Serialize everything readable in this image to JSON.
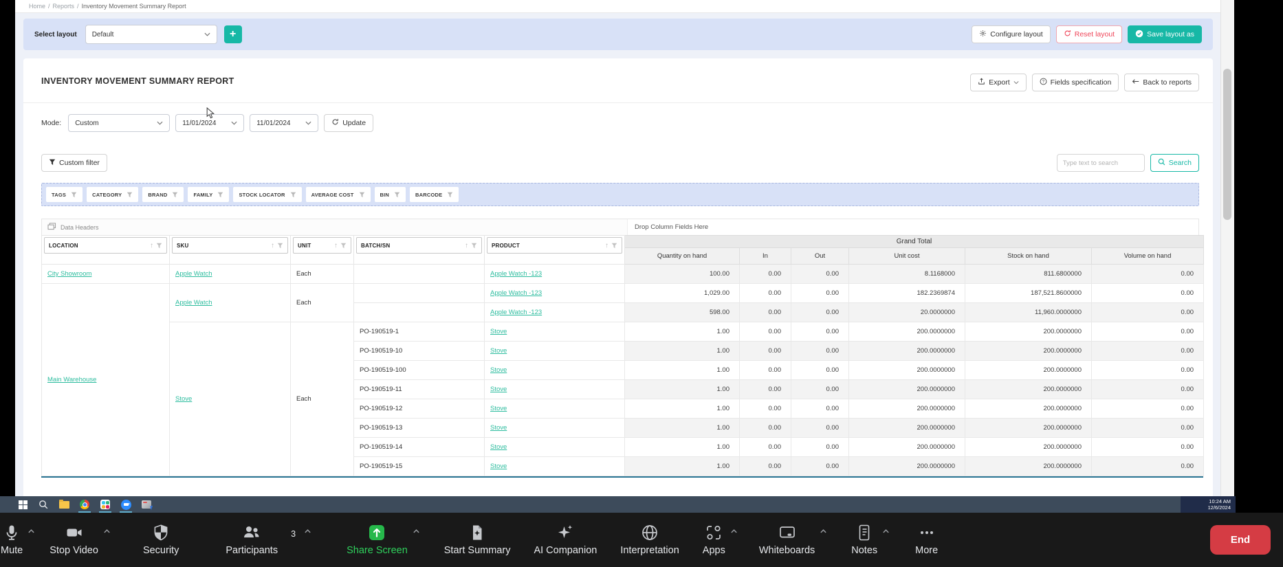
{
  "breadcrumb": {
    "items": [
      "Home",
      "Reports",
      "Inventory Movement Summary Report"
    ],
    "separator": "/"
  },
  "layout_bar": {
    "select_label": "Select layout",
    "selected": "Default",
    "add": "+",
    "configure": "Configure layout",
    "reset": "Reset layout",
    "save_as": "Save layout as"
  },
  "report": {
    "title": "INVENTORY MOVEMENT SUMMARY REPORT"
  },
  "toolbar": {
    "export": "Export",
    "fields_specification": "Fields specification",
    "back_to_reports": "Back to reports"
  },
  "filters": {
    "mode_label": "Mode:",
    "mode_value": "Custom",
    "date_from": "11/01/2024",
    "date_to": "11/01/2024",
    "update": "Update",
    "custom_filter": "Custom filter",
    "search_placeholder": "Type text to search",
    "search": "Search"
  },
  "chips": [
    "TAGS",
    "CATEGORY",
    "BRAND",
    "FAMILY",
    "STOCK LOCATOR",
    "AVERAGE COST",
    "BIN",
    "BARCODE"
  ],
  "grid": {
    "data_headers": "Data Headers",
    "drop_here": "Drop Column Fields Here",
    "grand_total": "Grand Total",
    "left_headers": [
      "LOCATION",
      "SKU",
      "UNIT",
      "BATCH/SN",
      "PRODUCT"
    ],
    "value_headers": [
      "Quantity on hand",
      "In",
      "Out",
      "Unit cost",
      "Stock on hand",
      "Volume on hand"
    ],
    "rows": [
      {
        "cells": [
          {
            "v": "City Showroom",
            "k": "link"
          },
          {
            "v": "Apple Watch",
            "k": "link"
          },
          {
            "v": "Each",
            "k": "text"
          },
          {
            "v": "",
            "k": "text"
          },
          {
            "v": "Apple Watch -123",
            "k": "link"
          },
          {
            "v": "100.00",
            "k": "num"
          },
          {
            "v": "0.00",
            "k": "num"
          },
          {
            "v": "0.00",
            "k": "num"
          },
          {
            "v": "8.1168000",
            "k": "num"
          },
          {
            "v": "811.6800000",
            "k": "num"
          },
          {
            "v": "0.00",
            "k": "num"
          }
        ]
      },
      {
        "cells": [
          {
            "v": "Main Warehouse",
            "k": "link",
            "rs": 10
          },
          {
            "v": "Apple Watch",
            "k": "link",
            "rs": 2
          },
          {
            "v": "Each",
            "k": "text",
            "rs": 2
          },
          {
            "v": "",
            "k": "text"
          },
          {
            "v": "Apple Watch -123",
            "k": "link"
          },
          {
            "v": "1,029.00",
            "k": "num"
          },
          {
            "v": "0.00",
            "k": "num"
          },
          {
            "v": "0.00",
            "k": "num"
          },
          {
            "v": "182.2369874",
            "k": "num"
          },
          {
            "v": "187,521.8600000",
            "k": "num"
          },
          {
            "v": "0.00",
            "k": "num"
          }
        ]
      },
      {
        "cells": [
          {
            "v": "",
            "k": "text"
          },
          {
            "v": "Apple Watch -123",
            "k": "link"
          },
          {
            "v": "598.00",
            "k": "num"
          },
          {
            "v": "0.00",
            "k": "num"
          },
          {
            "v": "0.00",
            "k": "num"
          },
          {
            "v": "20.0000000",
            "k": "num"
          },
          {
            "v": "11,960.0000000",
            "k": "num"
          },
          {
            "v": "0.00",
            "k": "num"
          }
        ]
      },
      {
        "cells": [
          {
            "v": "Stove",
            "k": "link",
            "rs": 8
          },
          {
            "v": "Each",
            "k": "text",
            "rs": 8
          },
          {
            "v": "PO-190519-1",
            "k": "text"
          },
          {
            "v": "Stove",
            "k": "link"
          },
          {
            "v": "1.00",
            "k": "num"
          },
          {
            "v": "0.00",
            "k": "num"
          },
          {
            "v": "0.00",
            "k": "num"
          },
          {
            "v": "200.0000000",
            "k": "num"
          },
          {
            "v": "200.0000000",
            "k": "num"
          },
          {
            "v": "0.00",
            "k": "num"
          }
        ]
      },
      {
        "cells": [
          {
            "v": "PO-190519-10",
            "k": "text"
          },
          {
            "v": "Stove",
            "k": "link"
          },
          {
            "v": "1.00",
            "k": "num"
          },
          {
            "v": "0.00",
            "k": "num"
          },
          {
            "v": "0.00",
            "k": "num"
          },
          {
            "v": "200.0000000",
            "k": "num"
          },
          {
            "v": "200.0000000",
            "k": "num"
          },
          {
            "v": "0.00",
            "k": "num"
          }
        ]
      },
      {
        "cells": [
          {
            "v": "PO-190519-100",
            "k": "text"
          },
          {
            "v": "Stove",
            "k": "link"
          },
          {
            "v": "1.00",
            "k": "num"
          },
          {
            "v": "0.00",
            "k": "num"
          },
          {
            "v": "0.00",
            "k": "num"
          },
          {
            "v": "200.0000000",
            "k": "num"
          },
          {
            "v": "200.0000000",
            "k": "num"
          },
          {
            "v": "0.00",
            "k": "num"
          }
        ]
      },
      {
        "cells": [
          {
            "v": "PO-190519-11",
            "k": "text"
          },
          {
            "v": "Stove",
            "k": "link"
          },
          {
            "v": "1.00",
            "k": "num"
          },
          {
            "v": "0.00",
            "k": "num"
          },
          {
            "v": "0.00",
            "k": "num"
          },
          {
            "v": "200.0000000",
            "k": "num"
          },
          {
            "v": "200.0000000",
            "k": "num"
          },
          {
            "v": "0.00",
            "k": "num"
          }
        ]
      },
      {
        "cells": [
          {
            "v": "PO-190519-12",
            "k": "text"
          },
          {
            "v": "Stove",
            "k": "link"
          },
          {
            "v": "1.00",
            "k": "num"
          },
          {
            "v": "0.00",
            "k": "num"
          },
          {
            "v": "0.00",
            "k": "num"
          },
          {
            "v": "200.0000000",
            "k": "num"
          },
          {
            "v": "200.0000000",
            "k": "num"
          },
          {
            "v": "0.00",
            "k": "num"
          }
        ]
      },
      {
        "cells": [
          {
            "v": "PO-190519-13",
            "k": "text"
          },
          {
            "v": "Stove",
            "k": "link"
          },
          {
            "v": "1.00",
            "k": "num"
          },
          {
            "v": "0.00",
            "k": "num"
          },
          {
            "v": "0.00",
            "k": "num"
          },
          {
            "v": "200.0000000",
            "k": "num"
          },
          {
            "v": "200.0000000",
            "k": "num"
          },
          {
            "v": "0.00",
            "k": "num"
          }
        ]
      },
      {
        "cells": [
          {
            "v": "PO-190519-14",
            "k": "text"
          },
          {
            "v": "Stove",
            "k": "link"
          },
          {
            "v": "1.00",
            "k": "num"
          },
          {
            "v": "0.00",
            "k": "num"
          },
          {
            "v": "0.00",
            "k": "num"
          },
          {
            "v": "200.0000000",
            "k": "num"
          },
          {
            "v": "200.0000000",
            "k": "num"
          },
          {
            "v": "0.00",
            "k": "num"
          }
        ]
      },
      {
        "cells": [
          {
            "v": "PO-190519-15",
            "k": "text"
          },
          {
            "v": "Stove",
            "k": "link"
          },
          {
            "v": "1.00",
            "k": "num"
          },
          {
            "v": "0.00",
            "k": "num"
          },
          {
            "v": "0.00",
            "k": "num"
          },
          {
            "v": "200.0000000",
            "k": "num"
          },
          {
            "v": "200.0000000",
            "k": "num"
          },
          {
            "v": "0.00",
            "k": "num"
          }
        ]
      }
    ]
  },
  "taskbar": {
    "time": "10:24 AM",
    "date": "12/6/2024"
  },
  "meeting_toolbar": {
    "items": [
      {
        "label": "Mute",
        "chevron": true
      },
      {
        "label": "Stop Video",
        "chevron": true
      },
      {
        "label": "Security",
        "chevron": false
      },
      {
        "label": "Participants",
        "chevron": true,
        "badge": "3"
      },
      {
        "label": "Share Screen",
        "chevron": true
      },
      {
        "label": "Start Summary",
        "chevron": false
      },
      {
        "label": "AI Companion",
        "chevron": false
      },
      {
        "label": "Interpretation",
        "chevron": false
      },
      {
        "label": "Apps",
        "chevron": true
      },
      {
        "label": "Whiteboards",
        "chevron": true
      },
      {
        "label": "Notes",
        "chevron": true
      },
      {
        "label": "More",
        "chevron": false
      }
    ],
    "end": "End"
  },
  "colors": {
    "accent_teal": "#17b8a6",
    "link_teal": "#2cbc9e",
    "danger_red": "#ef4458",
    "end_red": "#d53c44",
    "bar_blue": "#d8e1f7",
    "share_green": "#26b84b"
  }
}
